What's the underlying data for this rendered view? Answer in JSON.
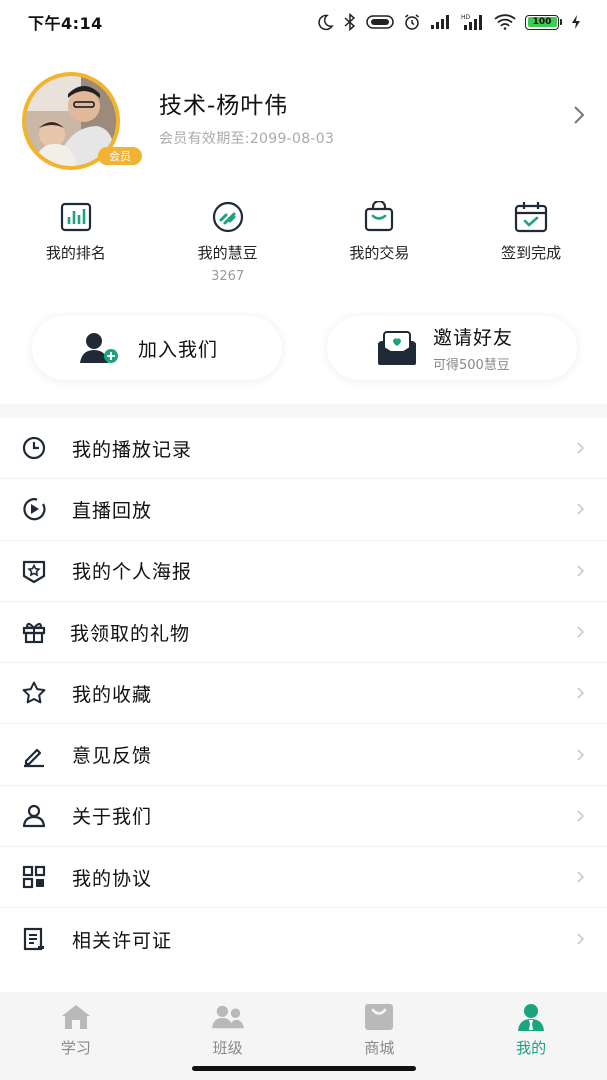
{
  "status_bar": {
    "time": "下午4:14",
    "battery": "100",
    "icons": [
      "moon-icon",
      "bluetooth-icon",
      "vibrate-icon",
      "alarm-icon",
      "signal-icon",
      "signal-hd-icon",
      "wifi-icon",
      "battery-icon",
      "charging-icon"
    ]
  },
  "profile": {
    "name": "技术-杨叶伟",
    "expire": "会员有效期至:2099-08-03",
    "badge": "会员"
  },
  "quick_actions": [
    {
      "label": "我的排名",
      "icon": "ranking-chart-icon"
    },
    {
      "label": "我的慧豆",
      "sub": "3267",
      "icon": "beans-icon"
    },
    {
      "label": "我的交易",
      "icon": "shopping-bag-icon"
    },
    {
      "label": "签到完成",
      "icon": "calendar-check-icon"
    }
  ],
  "cards": {
    "join": {
      "title": "加入我们",
      "icon": "add-user-icon"
    },
    "invite": {
      "title": "邀请好友",
      "sub": "可得500慧豆",
      "icon": "invite-envelope-icon"
    }
  },
  "menu": [
    {
      "label": "我的播放记录",
      "icon": "clock-icon"
    },
    {
      "label": "直播回放",
      "icon": "play-circle-icon"
    },
    {
      "label": "我的个人海报",
      "icon": "poster-star-icon"
    },
    {
      "label": "我领取的礼物",
      "icon": "gift-icon"
    },
    {
      "label": "我的收藏",
      "icon": "star-icon"
    },
    {
      "label": "意见反馈",
      "icon": "edit-icon"
    },
    {
      "label": "关于我们",
      "icon": "user-icon"
    },
    {
      "label": "我的协议",
      "icon": "grid-icon"
    },
    {
      "label": "相关许可证",
      "icon": "license-icon"
    }
  ],
  "bottom_nav": [
    {
      "label": "学习",
      "icon": "home-icon",
      "active": false
    },
    {
      "label": "班级",
      "icon": "class-icon",
      "active": false
    },
    {
      "label": "商城",
      "icon": "shop-icon",
      "active": false
    },
    {
      "label": "我的",
      "icon": "profile-icon",
      "active": true
    }
  ],
  "colors": {
    "accent": "#1aa57f",
    "vip_gold": "#f2b233",
    "battery_green": "#3ecb4f"
  }
}
